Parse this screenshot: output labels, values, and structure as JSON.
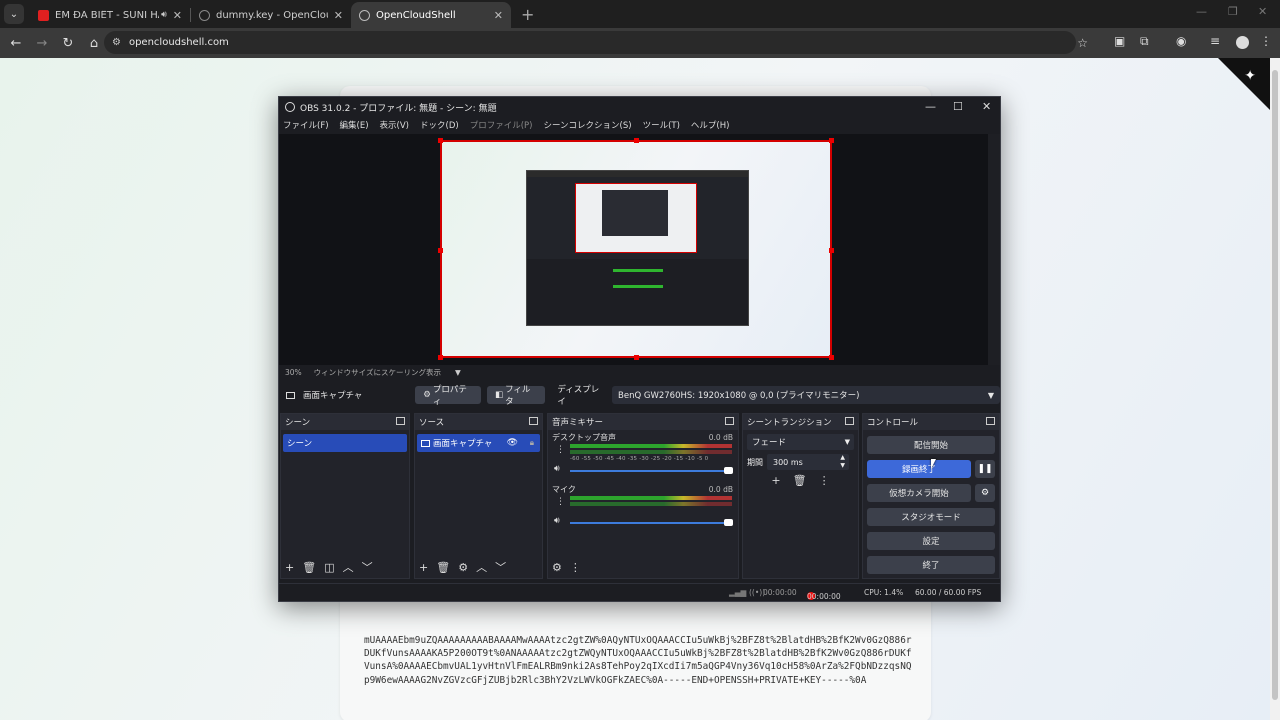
{
  "browser": {
    "tabs": [
      {
        "title": "EM ĐÃ BIẾT - SUNI HẠ LINH",
        "favicon_color": "#e02020",
        "audio": true
      },
      {
        "title": "dummy.key - OpenCloudShell",
        "favicon_color": "#8a8a8a",
        "audio": false
      },
      {
        "title": "OpenCloudShell",
        "favicon_color": "#bdbdbd",
        "audio": false,
        "active": true
      }
    ],
    "address": "opencloudshell.com"
  },
  "page": {
    "key_text": "mUAAAAEbm9uZQAAAAAAAAABAAAAMwAAAAtzc2gtZW%0AQyNTUxOQAAACCIu5uWkBj%2BFZ8t%2BlatdHB%2BfK2Wv0GzQ886rDUKfVunsAAAAKA5P200OT9t%0ANAAAAAtzc2gtZWQyNTUxOQAAACCIu5uWkBj%2BFZ8t%2BlatdHB%2BfK2Wv0GzQ886rDUKfVunsA%0AAAAECbmvUAL1yvHtnVlFmEALRBm9nki2As8TehPoy2qIXcdIi7m5aQGP4Vny36Vq10cH58%0ArZa%2FQbNDzzqsNQp9W6ewAAAAG2NvZGVzcGFjZUBjb2Rlc3BhY2VzLWVkOGFkZAEC%0A-----END+OPENSSH+PRIVATE+KEY-----%0A"
  },
  "obs": {
    "title": "OBS 31.0.2 - プロファイル: 無題 - シーン: 無題",
    "menu": [
      {
        "label": "ファイル(F)",
        "disabled": false
      },
      {
        "label": "編集(E)",
        "disabled": false
      },
      {
        "label": "表示(V)",
        "disabled": false
      },
      {
        "label": "ドック(D)",
        "disabled": false
      },
      {
        "label": "プロファイル(P)",
        "disabled": true
      },
      {
        "label": "シーンコレクション(S)",
        "disabled": false
      },
      {
        "label": "ツール(T)",
        "disabled": false
      },
      {
        "label": "ヘルプ(H)",
        "disabled": false
      }
    ],
    "zoom": "30%",
    "zoom_label": "ウィンドウサイズにスケーリング表示",
    "source_bar": {
      "source_name": "画面キャプチャ",
      "properties": "プロパティ",
      "filters": "フィルタ",
      "display_label": "ディスプレイ",
      "display_value": "BenQ GW2760HS: 1920x1080 @ 0,0 (プライマリモニター)"
    },
    "docks": {
      "scenes": {
        "title": "シーン",
        "items": [
          "シーン"
        ]
      },
      "sources": {
        "title": "ソース",
        "items": [
          "画面キャプチャ"
        ]
      },
      "mixer": {
        "title": "音声ミキサー",
        "channels": [
          {
            "name": "デスクトップ音声",
            "db": "0.0 dB",
            "level": 0.92
          },
          {
            "name": "マイク",
            "db": "0.0 dB",
            "level": 0.55
          }
        ],
        "scale": "-60 -55 -50 -45 -40 -35 -30 -25 -20 -15 -10 -5 0"
      },
      "transitions": {
        "title": "シーントランジション",
        "type": "フェード",
        "duration_label": "期間",
        "duration": "300 ms"
      },
      "controls": {
        "title": "コントロール",
        "buttons": [
          "配信開始",
          "録画終了",
          "仮想カメラ開始",
          "スタジオモード",
          "設定",
          "終了"
        ]
      }
    },
    "status": {
      "stream_time": "00:00:00",
      "rec_time": "00:00:00",
      "cpu": "CPU: 1.4%",
      "fps": "60.00 / 60.00 FPS"
    }
  }
}
